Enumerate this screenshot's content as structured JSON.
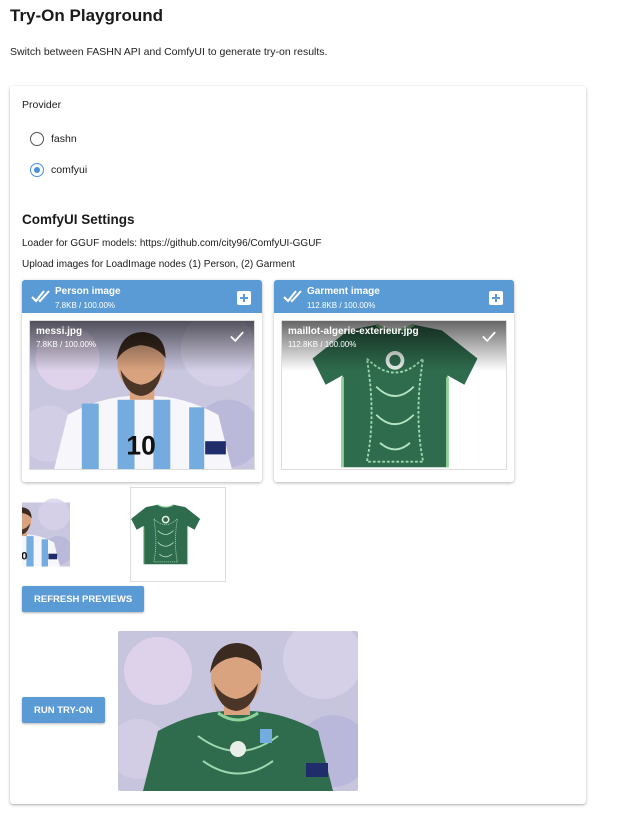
{
  "page": {
    "title": "Try-On Playground",
    "subtitle": "Switch between FASHN API and ComfyUI to generate try-on results."
  },
  "provider": {
    "label": "Provider",
    "options": [
      {
        "label": "fashn",
        "selected": false
      },
      {
        "label": "comfyui",
        "selected": true
      }
    ]
  },
  "comfy": {
    "title": "ComfyUI Settings",
    "loader_text": "Loader for GGUF models: https://github.com/city96/ComfyUI-GGUF",
    "upload_text": "Upload images for LoadImage nodes (1) Person, (2) Garment"
  },
  "uploaders": [
    {
      "title": "Person image",
      "meta": "7.8KB / 100.00%",
      "file_name": "messi.jpg",
      "file_meta": "7.8KB / 100.00%"
    },
    {
      "title": "Garment image",
      "meta": "112.8KB / 100.00%",
      "file_name": "maillot-algerie-exterieur.jpg",
      "file_meta": "112.8KB / 100.00%"
    }
  ],
  "buttons": {
    "refresh": "REFRESH PREVIEWS",
    "run": "RUN TRY-ON"
  },
  "colors": {
    "accent": "#5b9bd5",
    "argentina_blue": "#74acdf",
    "algeria_green": "#2f6b4d"
  },
  "icons": {
    "uploader_header": "double-check-icon",
    "uploader_add": "plus-icon",
    "file_done": "check-icon"
  }
}
